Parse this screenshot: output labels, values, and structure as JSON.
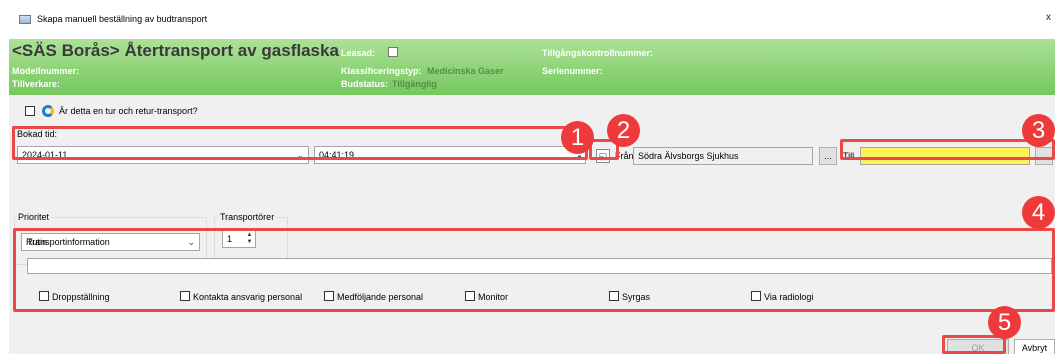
{
  "window": {
    "title": "Skapa manuell beställning av budtransport",
    "close_label": "x"
  },
  "header": {
    "title": "<SÄS Borås> Återtransport av gasflaska",
    "modell_label": "Modellnummer:",
    "tillverkare_label": "Tillverkare:",
    "leasad_label": "Leasad:",
    "klass_label": "Klassificeringstyp:",
    "klass_value": "Medicinska Gaser",
    "budstatus_label": "Budstatus:",
    "budstatus_value": "Tillgänglig",
    "tillgang_label": "Tillgångskontrollnummer:",
    "serie_label": "Serienummer:"
  },
  "form": {
    "retur_label": "Är detta en tur och retur-transport?",
    "bokad_label": "Bokad tid:",
    "date_value": "2024-01-11",
    "time_value": "04:41:19",
    "fran_label": "Från",
    "fran_value": "Södra Älvsborgs Sjukhus",
    "till_label": "Till",
    "till_value": "",
    "browse_label": "...",
    "prioritet_label": "Prioritet",
    "prioritet_value": "Rutin",
    "transportorer_label": "Transportörer",
    "transportorer_value": "1",
    "transportinfo_label": "Transportinformation",
    "transportinfo_value": "",
    "checkboxes": [
      "Droppställning",
      "Kontakta ansvarig personal",
      "Medföljande personal",
      "Monitor",
      "Syrgas",
      "Via radiologi"
    ],
    "ok_label": "OK",
    "avbryt_label": "Avbryt"
  },
  "annotations": [
    "1",
    "2",
    "3",
    "4",
    "5"
  ],
  "colors": {
    "header_green": "#74c85c",
    "annotation_red": "#e84a4a",
    "till_yellow": "#fff15a"
  }
}
